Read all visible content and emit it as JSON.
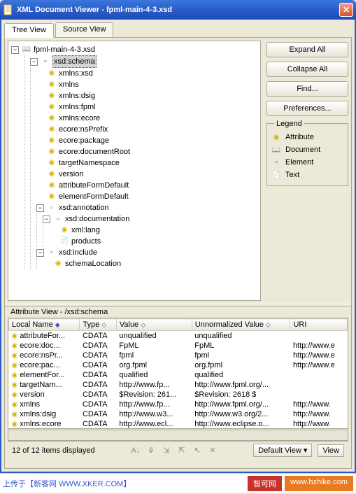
{
  "window": {
    "title": "XML Document Viewer - fpml-main-4-3.xsd"
  },
  "tabs": {
    "tree": "Tree View",
    "source": "Source View"
  },
  "sidebar": {
    "expand": "Expand All",
    "collapse": "Collapse All",
    "find": "Find...",
    "prefs": "Preferences..."
  },
  "legend": {
    "title": "Legend",
    "attribute": "Attribute",
    "document": "Document",
    "element": "Element",
    "text": "Text"
  },
  "tree": {
    "root": "fpml-main-4-3.xsd",
    "schema": "xsd:schema",
    "schema_attrs": [
      "xmlns:xsd",
      "xmlns",
      "xmlns:dsig",
      "xmlns:fpml",
      "xmlns:ecore",
      "ecore:nsPrefix",
      "ecore:package",
      "ecore:documentRoot",
      "targetNamespace",
      "version",
      "attributeFormDefault",
      "elementFormDefault"
    ],
    "annotation": "xsd:annotation",
    "documentation": "xsd:documentation",
    "xml_lang": "xml:lang",
    "products": "products",
    "include": "xsd:include",
    "schemaLocation": "schemaLocation"
  },
  "attrView": {
    "title": "Attribute View - /xsd:schema",
    "cols": {
      "local": "Local Name",
      "type": "Type",
      "value": "Value",
      "unnorm": "Unnormalized Value",
      "uri": "URI"
    },
    "rows": [
      {
        "name": "attributeFor...",
        "type": "CDATA",
        "value": "unqualified",
        "unnorm": "unqualified",
        "uri": ""
      },
      {
        "name": "ecore:doc...",
        "type": "CDATA",
        "value": "FpML",
        "unnorm": "FpML",
        "uri": "http://www.e"
      },
      {
        "name": "ecore:nsPr...",
        "type": "CDATA",
        "value": "fpml",
        "unnorm": "fpml",
        "uri": "http://www.e"
      },
      {
        "name": "ecore:pac...",
        "type": "CDATA",
        "value": "org.fpml",
        "unnorm": "org.fpml",
        "uri": "http://www.e"
      },
      {
        "name": "elementFor...",
        "type": "CDATA",
        "value": "qualified",
        "unnorm": "qualified",
        "uri": ""
      },
      {
        "name": "targetNam...",
        "type": "CDATA",
        "value": "http://www.fp...",
        "unnorm": "http://www.fpml.org/...",
        "uri": ""
      },
      {
        "name": "version",
        "type": "CDATA",
        "value": "$Revision: 261...",
        "unnorm": "$Revision: 2618 $",
        "uri": ""
      },
      {
        "name": "xmlns",
        "type": "CDATA",
        "value": "http://www.fp...",
        "unnorm": "http://www.fpml.org/...",
        "uri": "http://www."
      },
      {
        "name": "xmlns:dsig",
        "type": "CDATA",
        "value": "http://www.w3...",
        "unnorm": "http://www.w3.org/2...",
        "uri": "http://www."
      },
      {
        "name": "xmlns:ecore",
        "type": "CDATA",
        "value": "http://www.ecl...",
        "unnorm": "http://www.eclipse.o...",
        "uri": "http://www."
      }
    ],
    "status": "12 of 12 items displayed",
    "defaultView": "Default View",
    "viewBtn": "View"
  },
  "footer": {
    "uploadTo": "上传于【新客网 WWW.XKER.COM】",
    "badge1": "智可网",
    "badge2": "www.hzhike.com"
  }
}
